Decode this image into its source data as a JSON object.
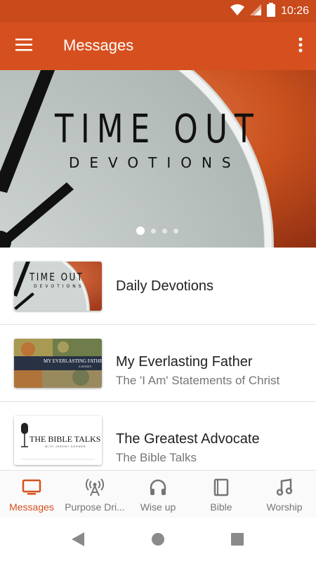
{
  "status_bar": {
    "time": "10:26"
  },
  "app_bar": {
    "title": "Messages"
  },
  "banner": {
    "title": "TIME OUT",
    "subtitle": "DEVOTIONS",
    "page_count": 4,
    "active_page": 1
  },
  "list": {
    "items": [
      {
        "title": "Daily Devotions",
        "subtitle": "",
        "thumb_text": "TIME OUT",
        "thumb_sub": "DEVOTIONS"
      },
      {
        "title": "My Everlasting Father",
        "subtitle": "The 'I Am' Statements of Christ",
        "thumb_text": "MY EVERLASTING FATHER",
        "thumb_sub": "A SERIES"
      },
      {
        "title": "The Greatest Advocate",
        "subtitle": "The Bible Talks",
        "thumb_text": "THE BIBLE TALKS",
        "thumb_sub": "WITH JEREMY DORMER"
      }
    ]
  },
  "bottom_nav": {
    "items": [
      {
        "label": "Messages",
        "icon": "tv-icon"
      },
      {
        "label": "Purpose Dri...",
        "icon": "broadcast-icon"
      },
      {
        "label": "Wise up",
        "icon": "headphones-icon"
      },
      {
        "label": "Bible",
        "icon": "book-icon"
      },
      {
        "label": "Worship",
        "icon": "music-note-icon"
      }
    ]
  },
  "colors": {
    "primary": "#d6501f",
    "status_bar": "#c94a1b",
    "inactive": "#757575"
  }
}
